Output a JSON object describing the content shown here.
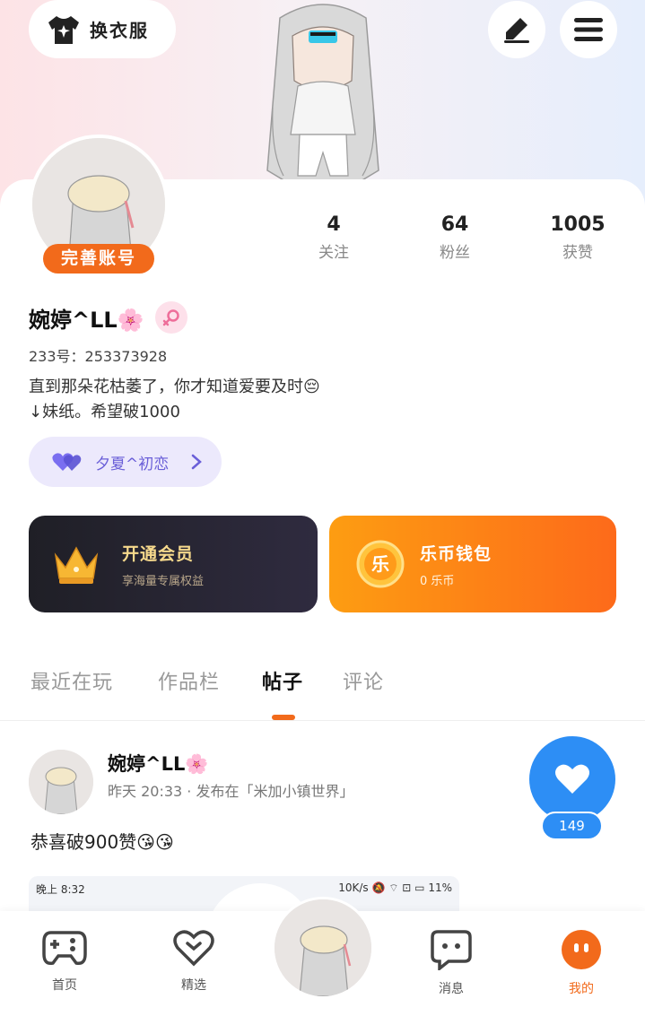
{
  "header": {
    "outfit_label": "换衣服"
  },
  "profile": {
    "complete_label": "完善账号",
    "stats": [
      {
        "value": "4",
        "label": "关注"
      },
      {
        "value": "64",
        "label": "粉丝"
      },
      {
        "value": "1005",
        "label": "获赞"
      }
    ],
    "username": "婉婷^LL🌸",
    "uid": "233号：253373928",
    "bio_line1": "直到那朵花枯萎了，你才知道爱要及时😔",
    "bio_line2": "↓妹纸。希望破1000",
    "cp_name": "夕夏^初恋"
  },
  "cards": {
    "vip_title": "开通会员",
    "vip_sub": "享海量专属权益",
    "wallet_title": "乐币钱包",
    "wallet_sub": "0 乐币",
    "wallet_coin_char": "乐"
  },
  "tabs": [
    {
      "label": "最近在玩"
    },
    {
      "label": "作品栏"
    },
    {
      "label": "帖子"
    },
    {
      "label": "评论"
    }
  ],
  "post": {
    "username": "婉婷^LL🌸",
    "meta": "昨天 20:33 · 发布在「米加小镇世界」",
    "text": "恭喜破900赞😘😘",
    "like_count": "149",
    "image_time": "晚上 8:32",
    "image_status": "10K/s 🔕 ⌔ ⊡ ▭ 11%"
  },
  "nav": [
    {
      "label": "首页"
    },
    {
      "label": "精选"
    },
    {
      "label": "消息"
    },
    {
      "label": "我的"
    }
  ],
  "colors": {
    "accent": "#f26a1b",
    "like_blue": "#2d8ef5",
    "cp_purple": "#6a5fd8"
  }
}
